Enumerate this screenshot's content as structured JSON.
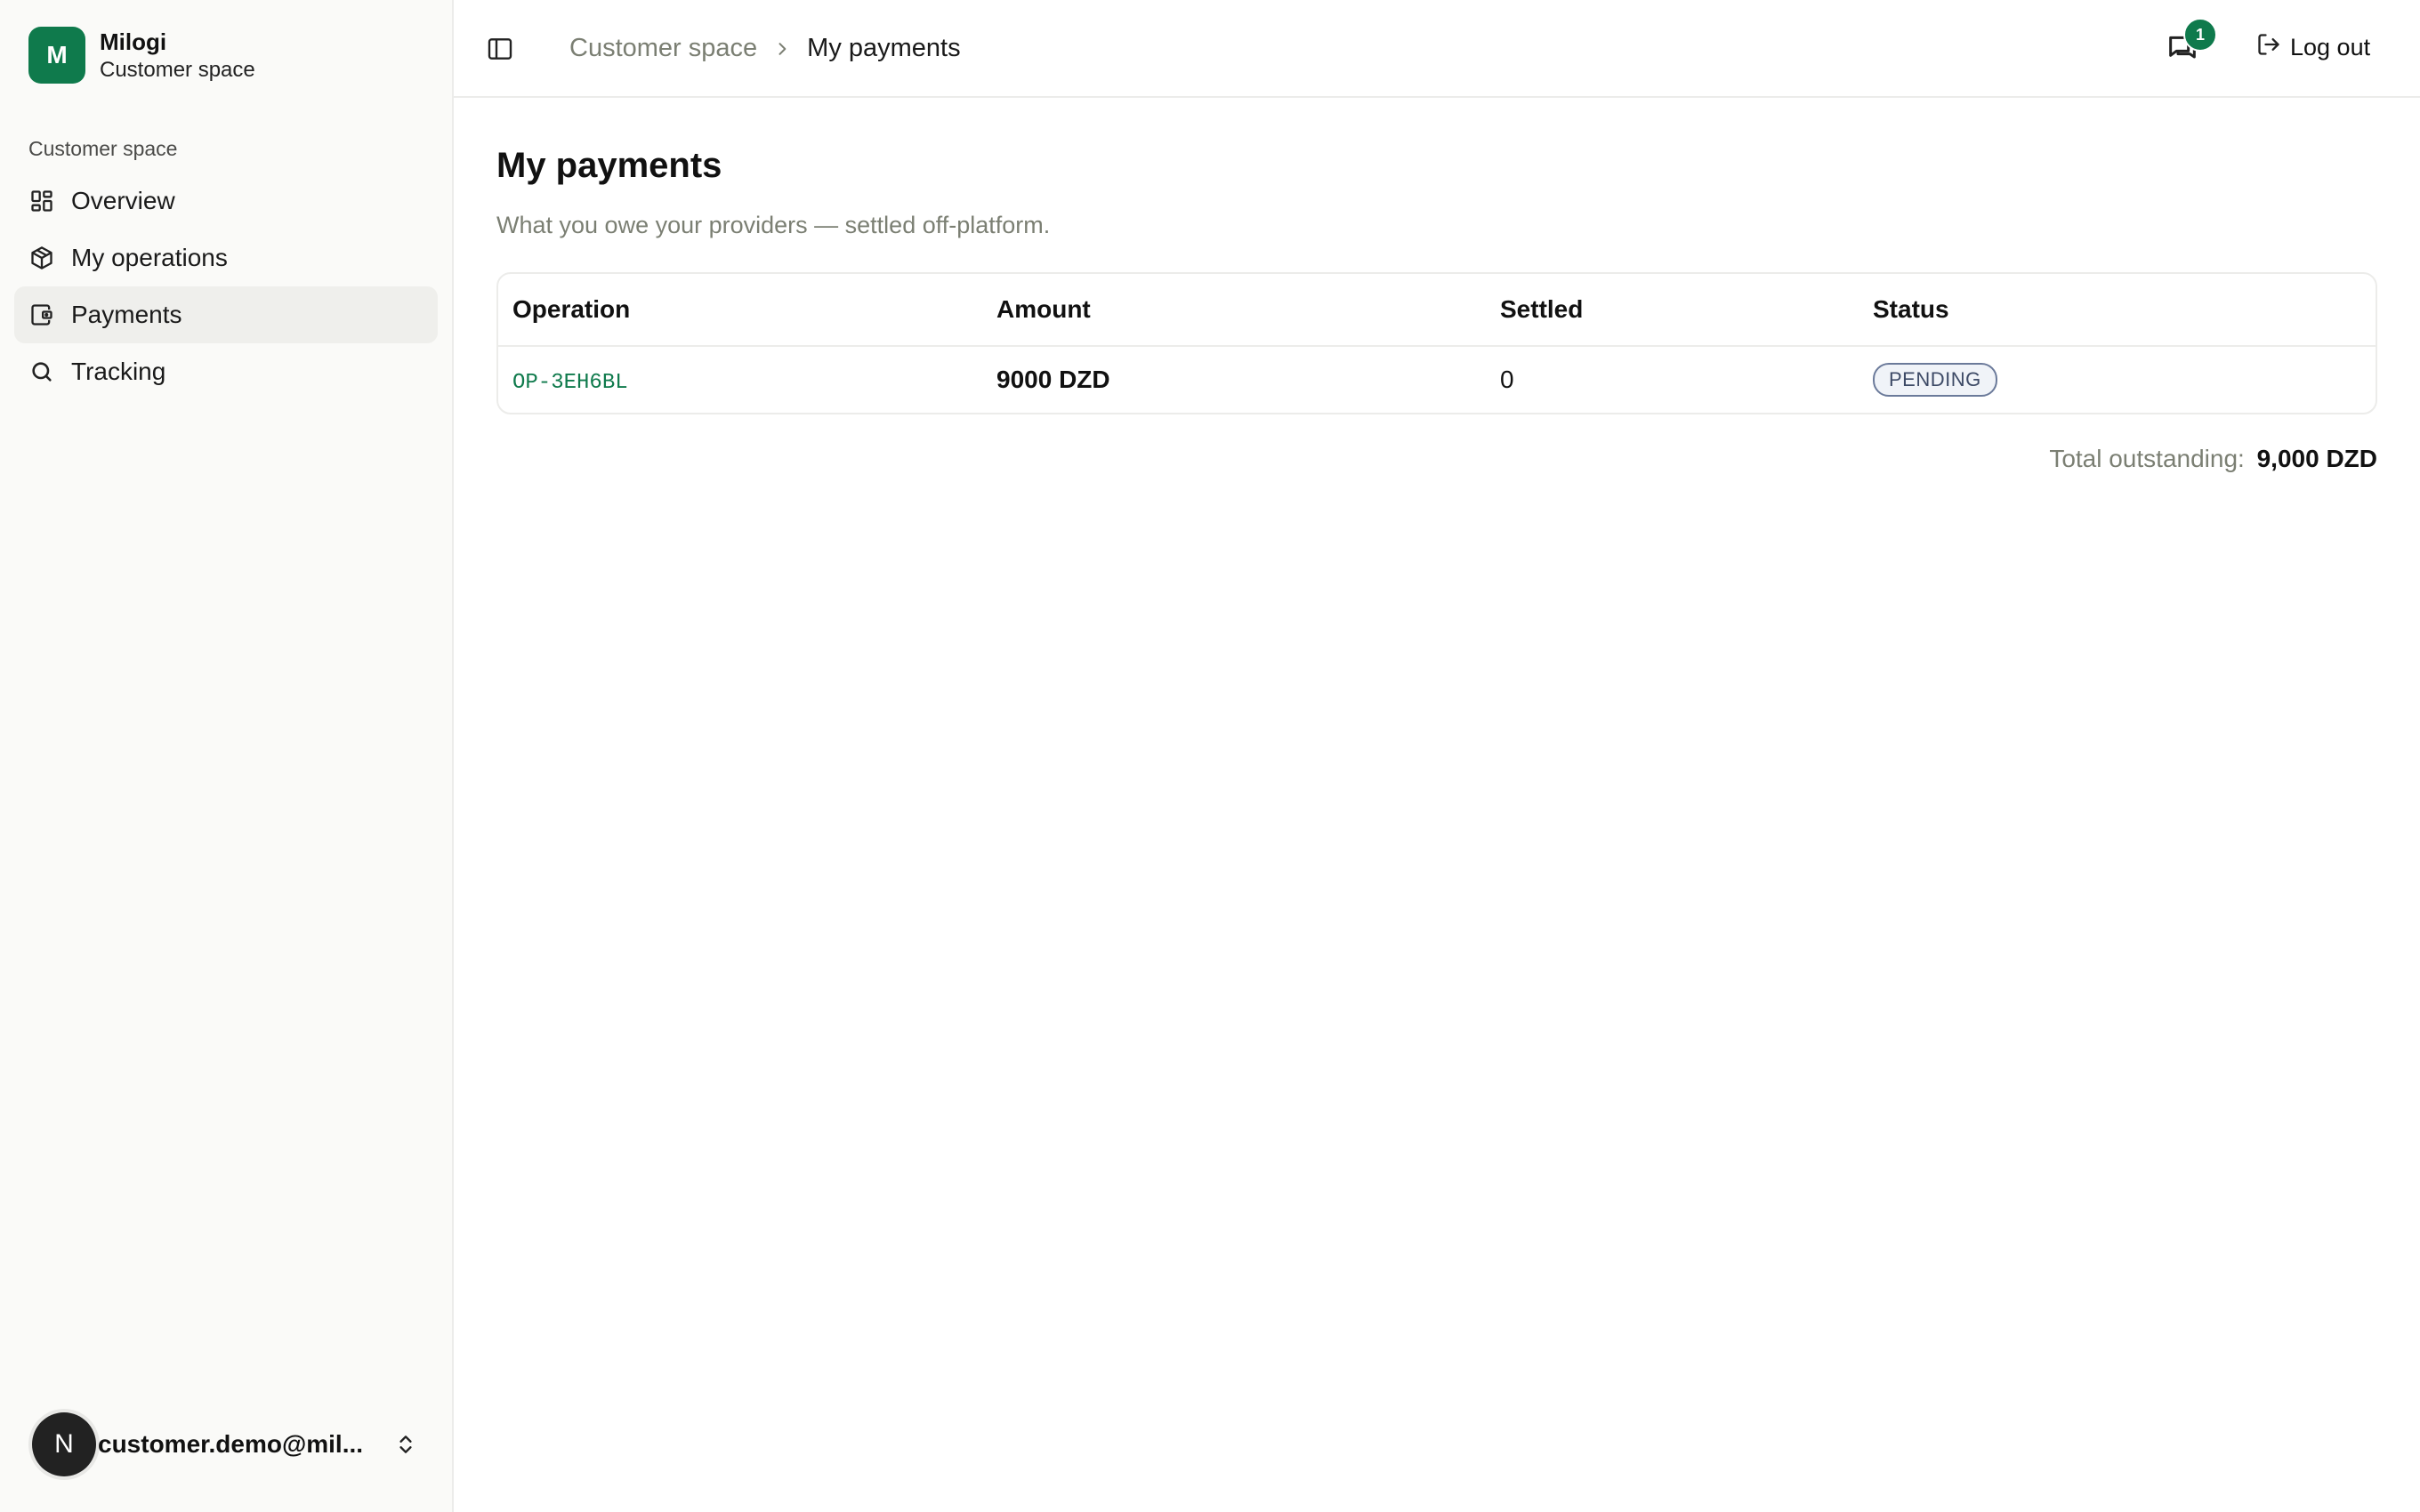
{
  "brand": {
    "logo_letter": "M",
    "name": "Milogi",
    "subtitle": "Customer space"
  },
  "sidebar": {
    "group_label": "Customer space",
    "items": [
      {
        "label": "Overview",
        "icon": "dashboard-icon",
        "active": false
      },
      {
        "label": "My operations",
        "icon": "package-icon",
        "active": false
      },
      {
        "label": "Payments",
        "icon": "wallet-icon",
        "active": true
      },
      {
        "label": "Tracking",
        "icon": "search-icon",
        "active": false
      }
    ],
    "user": {
      "avatar_letter": "N",
      "email": "customer.demo@mil..."
    }
  },
  "header": {
    "breadcrumb": {
      "parent": "Customer space",
      "current": "My payments"
    },
    "messages_badge": "1",
    "logout_label": "Log out"
  },
  "main": {
    "title": "My payments",
    "subtitle": "What you owe your providers — settled off-platform.",
    "table": {
      "columns": [
        "Operation",
        "Amount",
        "Settled",
        "Status"
      ],
      "rows": [
        {
          "operation": "OP-3EH6BL",
          "amount": "9000 DZD",
          "settled": "0",
          "status": "PENDING"
        }
      ]
    },
    "total": {
      "label": "Total outstanding:",
      "value": "9,000 DZD"
    }
  },
  "colors": {
    "accent": "#0f7a4c",
    "muted_text": "#7b7f73",
    "status_pending": "#6b7a9a"
  }
}
